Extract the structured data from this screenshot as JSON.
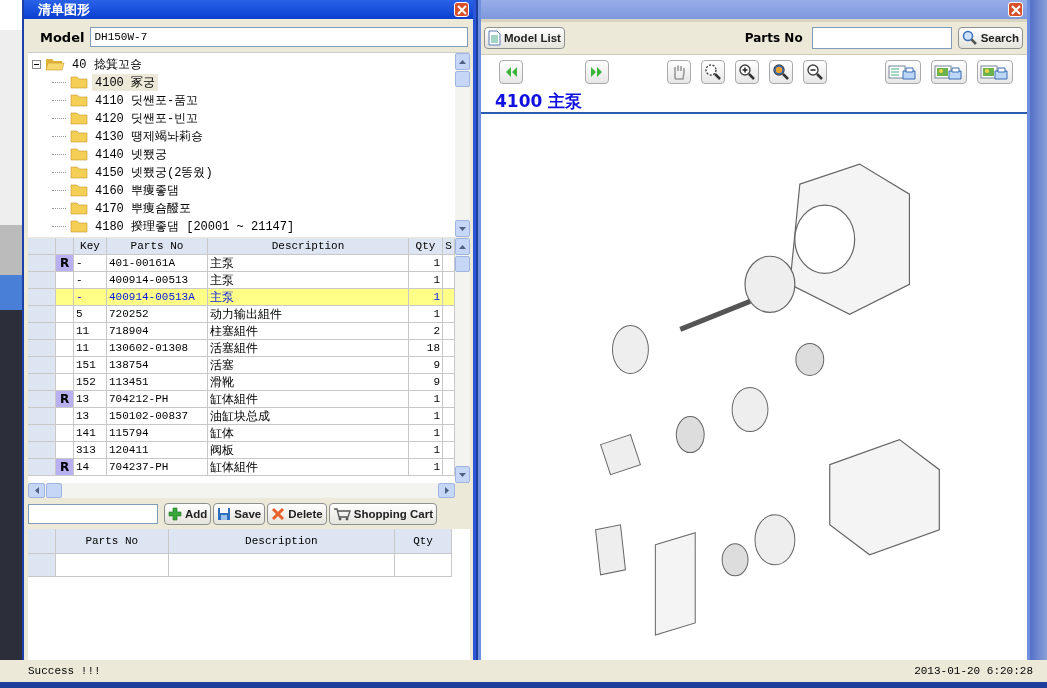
{
  "left_window": {
    "title": "清单图形",
    "model_label": "Model",
    "model_value": "DH150W-7"
  },
  "tree": {
    "label": "40 捻箕꼬숑",
    "expanded": true,
    "children": [
      {
        "label": "4100 冢궁",
        "selected": true
      },
      {
        "label": "4110 딧쌘포-품꼬",
        "selected": false
      },
      {
        "label": "4120 딧쌘포-빈꼬",
        "selected": false
      },
      {
        "label": "4130 땡제竭놔莉숑",
        "selected": false
      },
      {
        "label": "4140 넷쬈궁",
        "selected": false
      },
      {
        "label": "4150 넷쬈궁(2똥웠)",
        "selected": false
      },
      {
        "label": "4160 뿌痩좋댐",
        "selected": false
      },
      {
        "label": "4170 뿌痩숌醱포",
        "selected": false
      },
      {
        "label": "4180 揆理좋댐  [20001 ~ 21147]",
        "selected": false
      }
    ]
  },
  "parts_table": {
    "columns": [
      "Key",
      "Parts No",
      "Description",
      "Qty",
      "S"
    ],
    "rows": [
      {
        "mark": "R",
        "key": "-",
        "parts_no": "401-00161A",
        "description": "主泵",
        "qty": "1",
        "selected": false
      },
      {
        "key": "-",
        "parts_no": "400914-00513",
        "description": "主泵",
        "qty": "1",
        "selected": false
      },
      {
        "key": "-",
        "parts_no": "400914-00513A",
        "description": "主泵",
        "qty": "1",
        "selected": true
      },
      {
        "key": "5",
        "parts_no": "720252",
        "description": "动力输出組件",
        "qty": "1",
        "selected": false
      },
      {
        "key": "11",
        "parts_no": "718904",
        "description": "柱塞組件",
        "qty": "2",
        "selected": false
      },
      {
        "key": "11",
        "parts_no": "130602-01308",
        "description": "活塞組件",
        "qty": "18",
        "selected": false
      },
      {
        "key": "151",
        "parts_no": "138754",
        "description": "活塞",
        "qty": "9",
        "selected": false
      },
      {
        "key": "152",
        "parts_no": "113451",
        "description": "滑靴",
        "qty": "9",
        "selected": false
      },
      {
        "mark": "R",
        "key": "13",
        "parts_no": "704212-PH",
        "description": "缸体組件",
        "qty": "1",
        "selected": false
      },
      {
        "key": "13",
        "parts_no": "150102-00837",
        "description": "油缸块总成",
        "qty": "1",
        "selected": false
      },
      {
        "key": "141",
        "parts_no": "115794",
        "description": "缸体",
        "qty": "1",
        "selected": false
      },
      {
        "key": "313",
        "parts_no": "120411",
        "description": "阀板",
        "qty": "1",
        "selected": false
      },
      {
        "mark": "R",
        "key": "14",
        "parts_no": "704237-PH",
        "description": "缸体組件",
        "qty": "1",
        "selected": false
      }
    ]
  },
  "cart_buttons": [
    "Add",
    "Save",
    "Delete",
    "Shopping Cart"
  ],
  "cart_table": {
    "columns": [
      "Parts No",
      "Description",
      "Qty"
    ]
  },
  "right_window": {
    "model_list_button": "Model List",
    "parts_no_label": "Parts No",
    "search_button": "Search",
    "heading": "4100 主泵"
  },
  "status_bar": {
    "message": "Success !!!",
    "datetime": "2013-01-20 6:20:28"
  }
}
